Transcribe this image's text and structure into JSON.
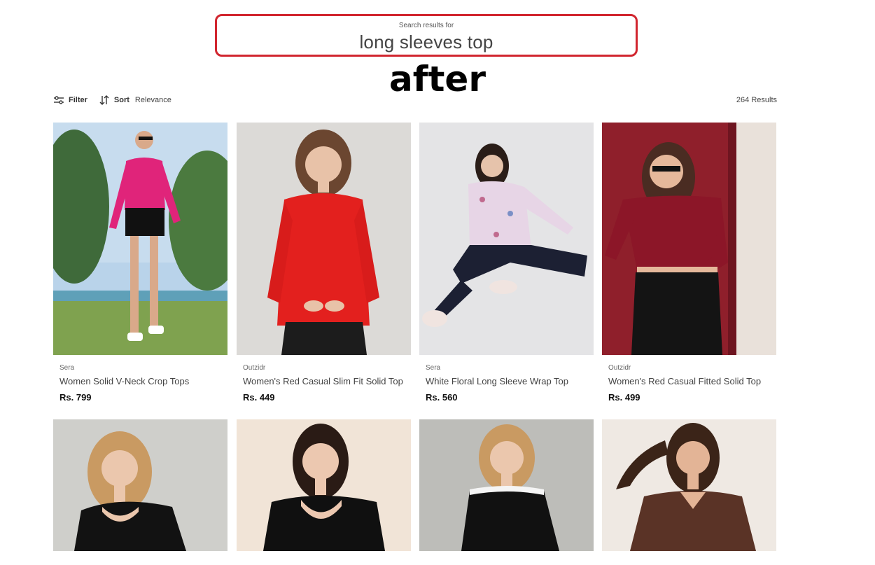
{
  "search": {
    "caption": "Search results for",
    "query": "long sleeves top"
  },
  "overlay_label": "after",
  "toolbar": {
    "filter_label": "Filter",
    "sort_label": "Sort",
    "sort_value": "Relevance",
    "results_count": "264 Results",
    "icons": [
      "filter-sliders-icon",
      "sort-arrows-icon"
    ]
  },
  "accent_color": "#d1262f",
  "products": [
    {
      "brand": "Sera",
      "title": "Women Solid V-Neck Crop Tops",
      "price": "Rs. 799"
    },
    {
      "brand": "Outzidr",
      "title": "Women's Red Casual Slim Fit Solid Top",
      "price": "Rs. 449"
    },
    {
      "brand": "Sera",
      "title": "White Floral Long Sleeve Wrap Top",
      "price": "Rs. 560"
    },
    {
      "brand": "Outzidr",
      "title": "Women's Red Casual Fitted Solid Top",
      "price": "Rs. 499"
    }
  ]
}
